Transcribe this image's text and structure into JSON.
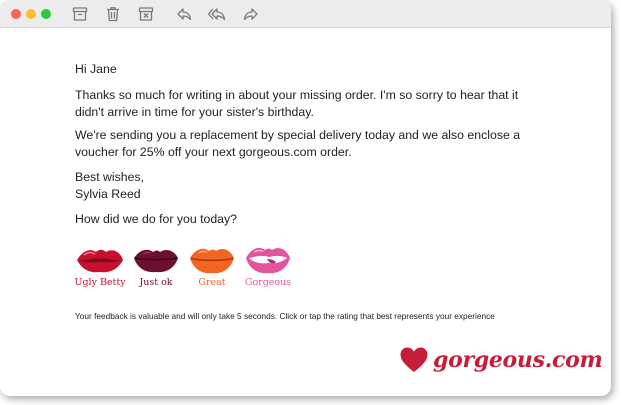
{
  "toolbar": {
    "icons": [
      "archive-icon",
      "trash-icon",
      "junk-icon",
      "reply-icon",
      "reply-all-icon",
      "forward-icon"
    ]
  },
  "email": {
    "greeting": "Hi Jane",
    "paragraph1": "Thanks so much for writing in about your missing order. I'm so sorry to hear that it didn't arrive in time for your sister's birthday.",
    "paragraph2": "We're sending you a replacement by special delivery today and we also enclose a voucher for 25% off your next gorgeous.com order.",
    "signoff": "Best wishes,",
    "signature": "Sylvia Reed",
    "question": "How did we do for you today?"
  },
  "ratings": [
    {
      "label": "Ugly Betty",
      "color": "#c8102e"
    },
    {
      "label": "Just ok",
      "color": "#6b1031"
    },
    {
      "label": "Great",
      "color": "#f26522"
    },
    {
      "label": "Gorgeous",
      "color": "#e3549e"
    }
  ],
  "feedback_note": "Your feedback is valuable and will only take 5 seconds. Click or tap the rating that best represents your experience",
  "brand": {
    "wordmark": "gorgeous.com",
    "color": "#c41e3a"
  }
}
